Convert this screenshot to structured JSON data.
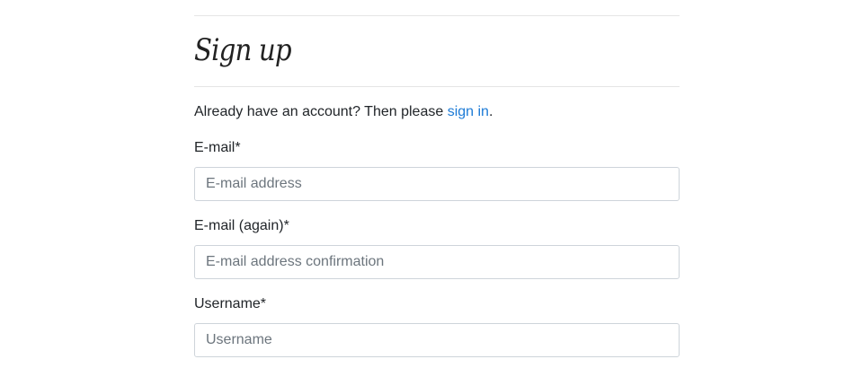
{
  "form": {
    "title": "Sign up",
    "intro_prefix": "Already have an account? Then please ",
    "signin_link": "sign in",
    "intro_suffix": ".",
    "fields": [
      {
        "label": "E-mail*",
        "placeholder": "E-mail address",
        "value": ""
      },
      {
        "label": "E-mail (again)*",
        "placeholder": "E-mail address confirmation",
        "value": ""
      },
      {
        "label": "Username*",
        "placeholder": "Username",
        "value": ""
      }
    ]
  },
  "colors": {
    "link": "#1b7ad6",
    "border": "#ced4da",
    "divider": "#e5e5e5"
  }
}
